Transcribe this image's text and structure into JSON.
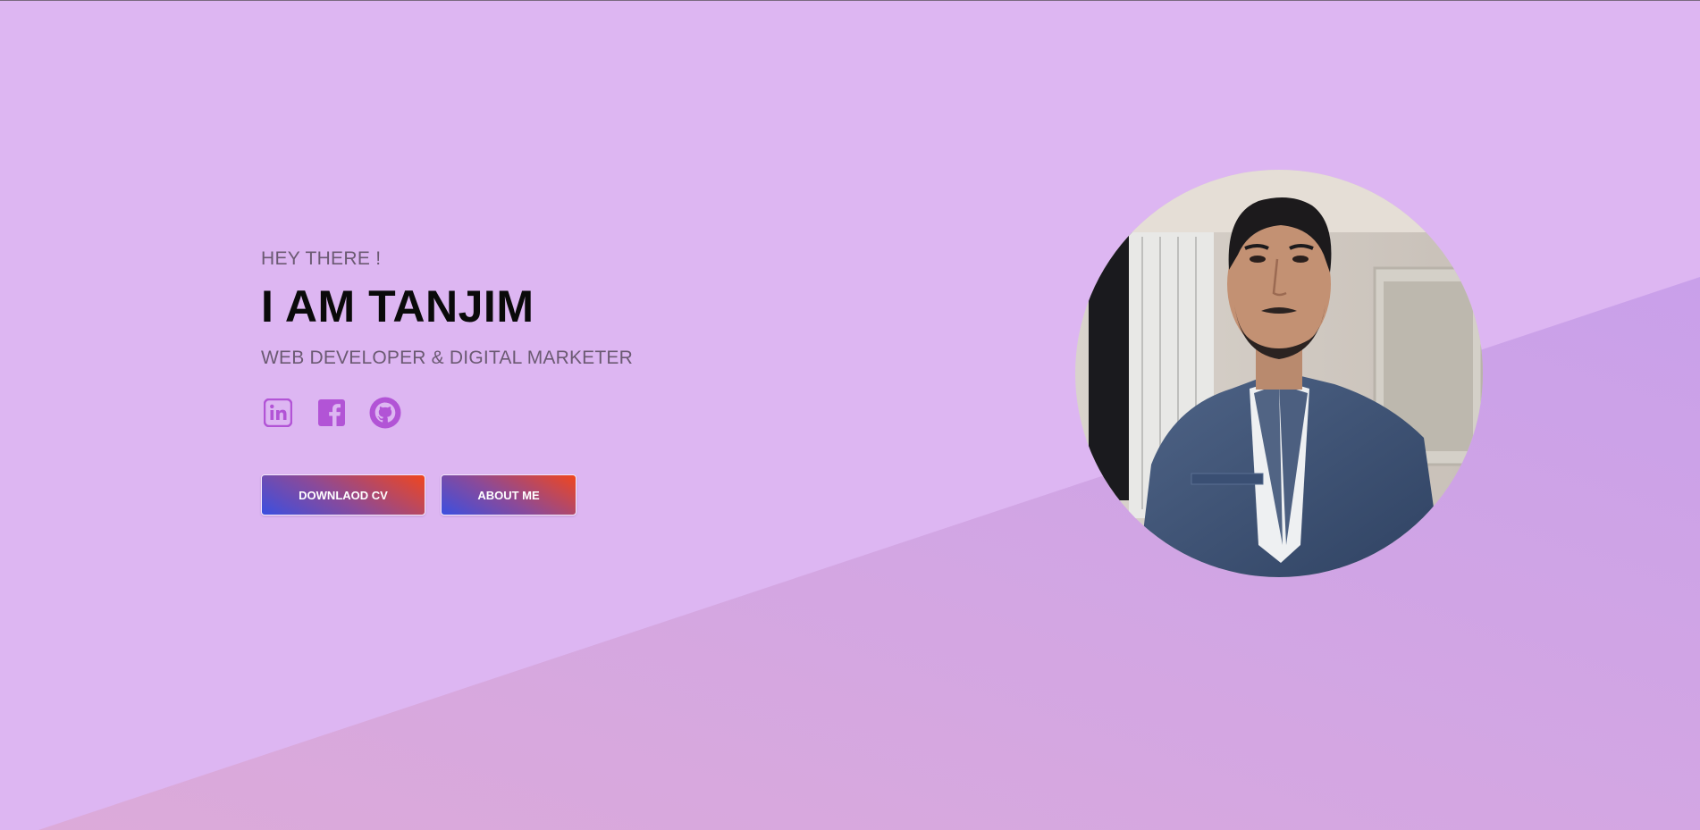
{
  "hero": {
    "greeting": "HEY THERE !",
    "name": "I AM TANJIM",
    "role": "WEB DEVELOPER & DIGITAL MARKETER"
  },
  "socials": [
    {
      "icon": "linkedin-icon"
    },
    {
      "icon": "facebook-icon"
    },
    {
      "icon": "github-icon"
    }
  ],
  "buttons": {
    "download_cv": "DOWNLAOD CV",
    "about_me": "ABOUT ME"
  },
  "colors": {
    "background": "#ddb6f2",
    "diagonal_band": "#cfa2e8",
    "icon_accent": "#b254d6",
    "button_gradient_start": "#3b4fe0",
    "button_gradient_end": "#f0461e"
  }
}
